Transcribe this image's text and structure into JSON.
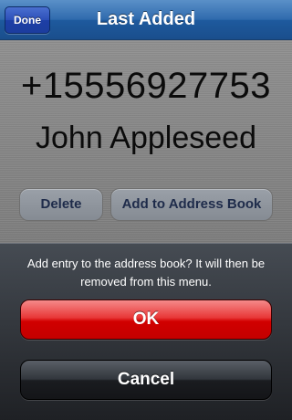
{
  "navbar": {
    "title": "Last Added",
    "done_label": "Done"
  },
  "contact": {
    "phone": "+15556927753",
    "name": "John Appleseed"
  },
  "actions": {
    "delete_label": "Delete",
    "add_label": "Add to Address Book"
  },
  "sheet": {
    "message": "Add entry to the address book? It will then be removed from this menu.",
    "ok_label": "OK",
    "cancel_label": "Cancel"
  },
  "colors": {
    "nav_blue": "#2f6aad",
    "ok_red": "#d10000",
    "cancel_dark": "#1a1c20"
  }
}
